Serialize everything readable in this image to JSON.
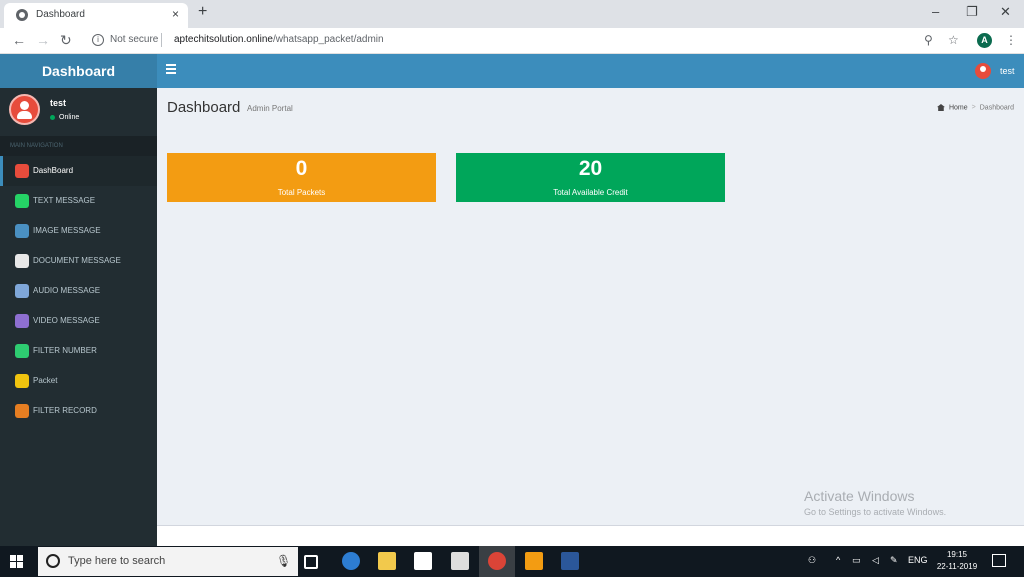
{
  "browser": {
    "tab_title": "Dashboard",
    "tab_close": "×",
    "new_tab": "+",
    "not_secure": "Not secure",
    "url_host": "aptechitsolution.online",
    "url_path": "/whatsapp_packet/admin",
    "profile_initial": "A",
    "window_min": "–",
    "window_restore": "❐",
    "window_close": "✕"
  },
  "app": {
    "logo": "Dashboard",
    "top_user_name": "test"
  },
  "sidebar": {
    "user_name": "test",
    "user_status": "Online",
    "nav_header": "MAIN NAVIGATION",
    "items": [
      {
        "label": "DashBoard",
        "icon": "home-icon",
        "color": "#e74c3c"
      },
      {
        "label": "TEXT MESSAGE",
        "icon": "whatsapp-icon",
        "color": "#25d366"
      },
      {
        "label": "IMAGE MESSAGE",
        "icon": "image-icon",
        "color": "#4a90c2"
      },
      {
        "label": "DOCUMENT MESSAGE",
        "icon": "document-icon",
        "color": "#e8e8e8"
      },
      {
        "label": "AUDIO MESSAGE",
        "icon": "audio-icon",
        "color": "#7fa7d9"
      },
      {
        "label": "VIDEO MESSAGE",
        "icon": "video-icon",
        "color": "#8e6fd1"
      },
      {
        "label": "FILTER NUMBER",
        "icon": "phone-icon",
        "color": "#2ecc71"
      },
      {
        "label": "Packet",
        "icon": "packet-icon",
        "color": "#f1c40f"
      },
      {
        "label": "FILTER RECORD",
        "icon": "record-icon",
        "color": "#e67e22"
      }
    ]
  },
  "content": {
    "title": "Dashboard",
    "subtitle": "Admin Portal",
    "breadcrumb_home": "Home",
    "breadcrumb_sep": ">",
    "breadcrumb_current": "Dashboard",
    "stats": [
      {
        "value": "0",
        "label": "Total Packets",
        "color": "#f39c12"
      },
      {
        "value": "20",
        "label": "Total Available Credit",
        "color": "#00a65a"
      }
    ]
  },
  "watermark": {
    "title": "Activate Windows",
    "subtitle": "Go to Settings to activate Windows."
  },
  "taskbar": {
    "search_placeholder": "Type here to search",
    "language": "ENG",
    "time": "19:15",
    "date": "22-11-2019"
  }
}
